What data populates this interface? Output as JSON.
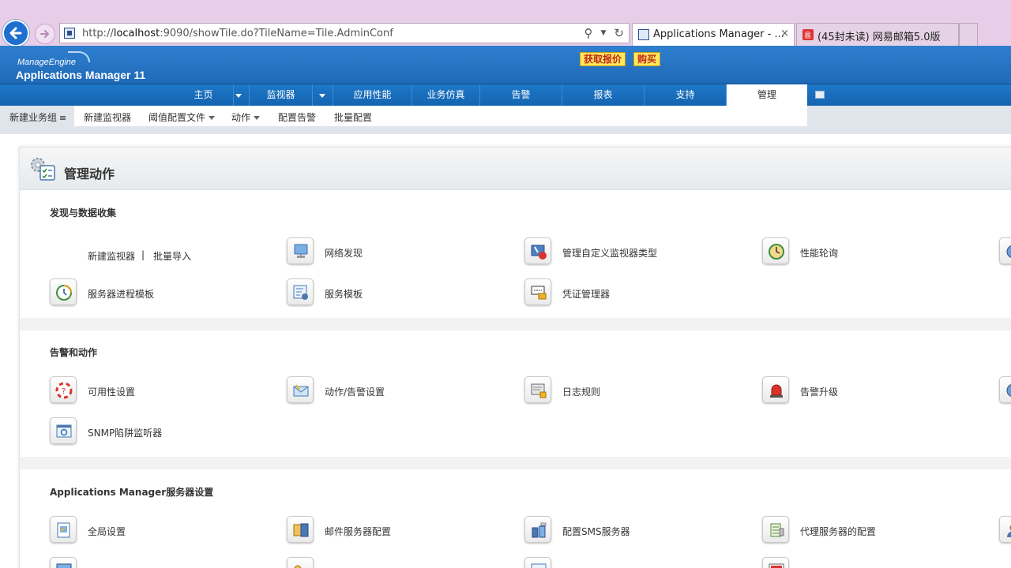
{
  "browser": {
    "url_prefix": "http://",
    "url_host": "localhost",
    "url_rest": ":9090/showTile.do?TileName=Tile.AdminConf",
    "tabs": [
      {
        "title": "Applications Manager - ...",
        "close": "×"
      },
      {
        "title": "(45封未读) 网易邮箱5.0版"
      }
    ]
  },
  "header": {
    "logo_top": "ManageEngine",
    "logo_main": "Applications Manager 11",
    "quote_label": "获取报价",
    "buy_label": "购买"
  },
  "nav": {
    "items": [
      "主页",
      "监视器",
      "应用性能",
      "业务仿真",
      "告警",
      "报表",
      "支持",
      "管理"
    ],
    "active": "管理"
  },
  "subnav": {
    "items": [
      "新建业务组",
      "新建监视器",
      "阈值配置文件",
      "动作",
      "配置告警",
      "批量配置"
    ]
  },
  "panel": {
    "title": "管理动作",
    "sections": [
      {
        "title": "发现与数据收集",
        "link_new_monitor": "新建监视器",
        "link_sep": "|",
        "link_bulk_import": "批量导入",
        "items": [
          "网络发现",
          "管理自定义监视器类型",
          "性能轮询",
          "服务器进程模板",
          "服务模板",
          "凭证管理器"
        ]
      },
      {
        "title": "告警和动作",
        "items": [
          "可用性设置",
          "动作/告警设置",
          "日志规则",
          "告警升级",
          "SNMP陷阱监听器"
        ]
      },
      {
        "title": "Applications Manager服务器设置",
        "items": [
          "全局设置",
          "邮件服务器配置",
          "配置SMS服务器",
          "代理服务器的配置"
        ]
      }
    ]
  },
  "colors": {
    "header_blue": "#2f7fcf",
    "nav_blue": "#1e78c8",
    "promo_yellow": "#fde95a",
    "chrome_pink": "#e8cde8"
  }
}
